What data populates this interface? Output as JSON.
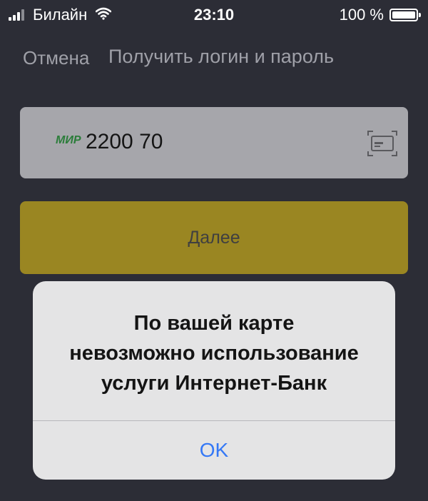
{
  "status_bar": {
    "carrier": "Билайн",
    "time": "23:10",
    "battery": "100 %",
    "battery_level": 1.0,
    "signal_icon": "signal-bars-icon",
    "wifi_icon": "wifi-icon",
    "battery_icon": "battery-icon"
  },
  "nav": {
    "cancel_label": "Отмена",
    "title": "Получить логин и пароль"
  },
  "card_input": {
    "brand": "МИР",
    "value": "2200 70",
    "scan_icon": "card-scan-icon"
  },
  "next_button": {
    "label": "Далее"
  },
  "alert": {
    "message_lines": [
      "По вашей карте",
      "невозможно использование",
      "услуги Интернет-Банк"
    ],
    "ok_label": "OK"
  },
  "colors": {
    "background": "#2c2d36",
    "input_bg": "#a6a6ab",
    "button_bg": "#9a8622",
    "alert_bg": "#e4e4e5",
    "alert_action": "#3478f6",
    "mir_brand": "#2b7d3a"
  }
}
